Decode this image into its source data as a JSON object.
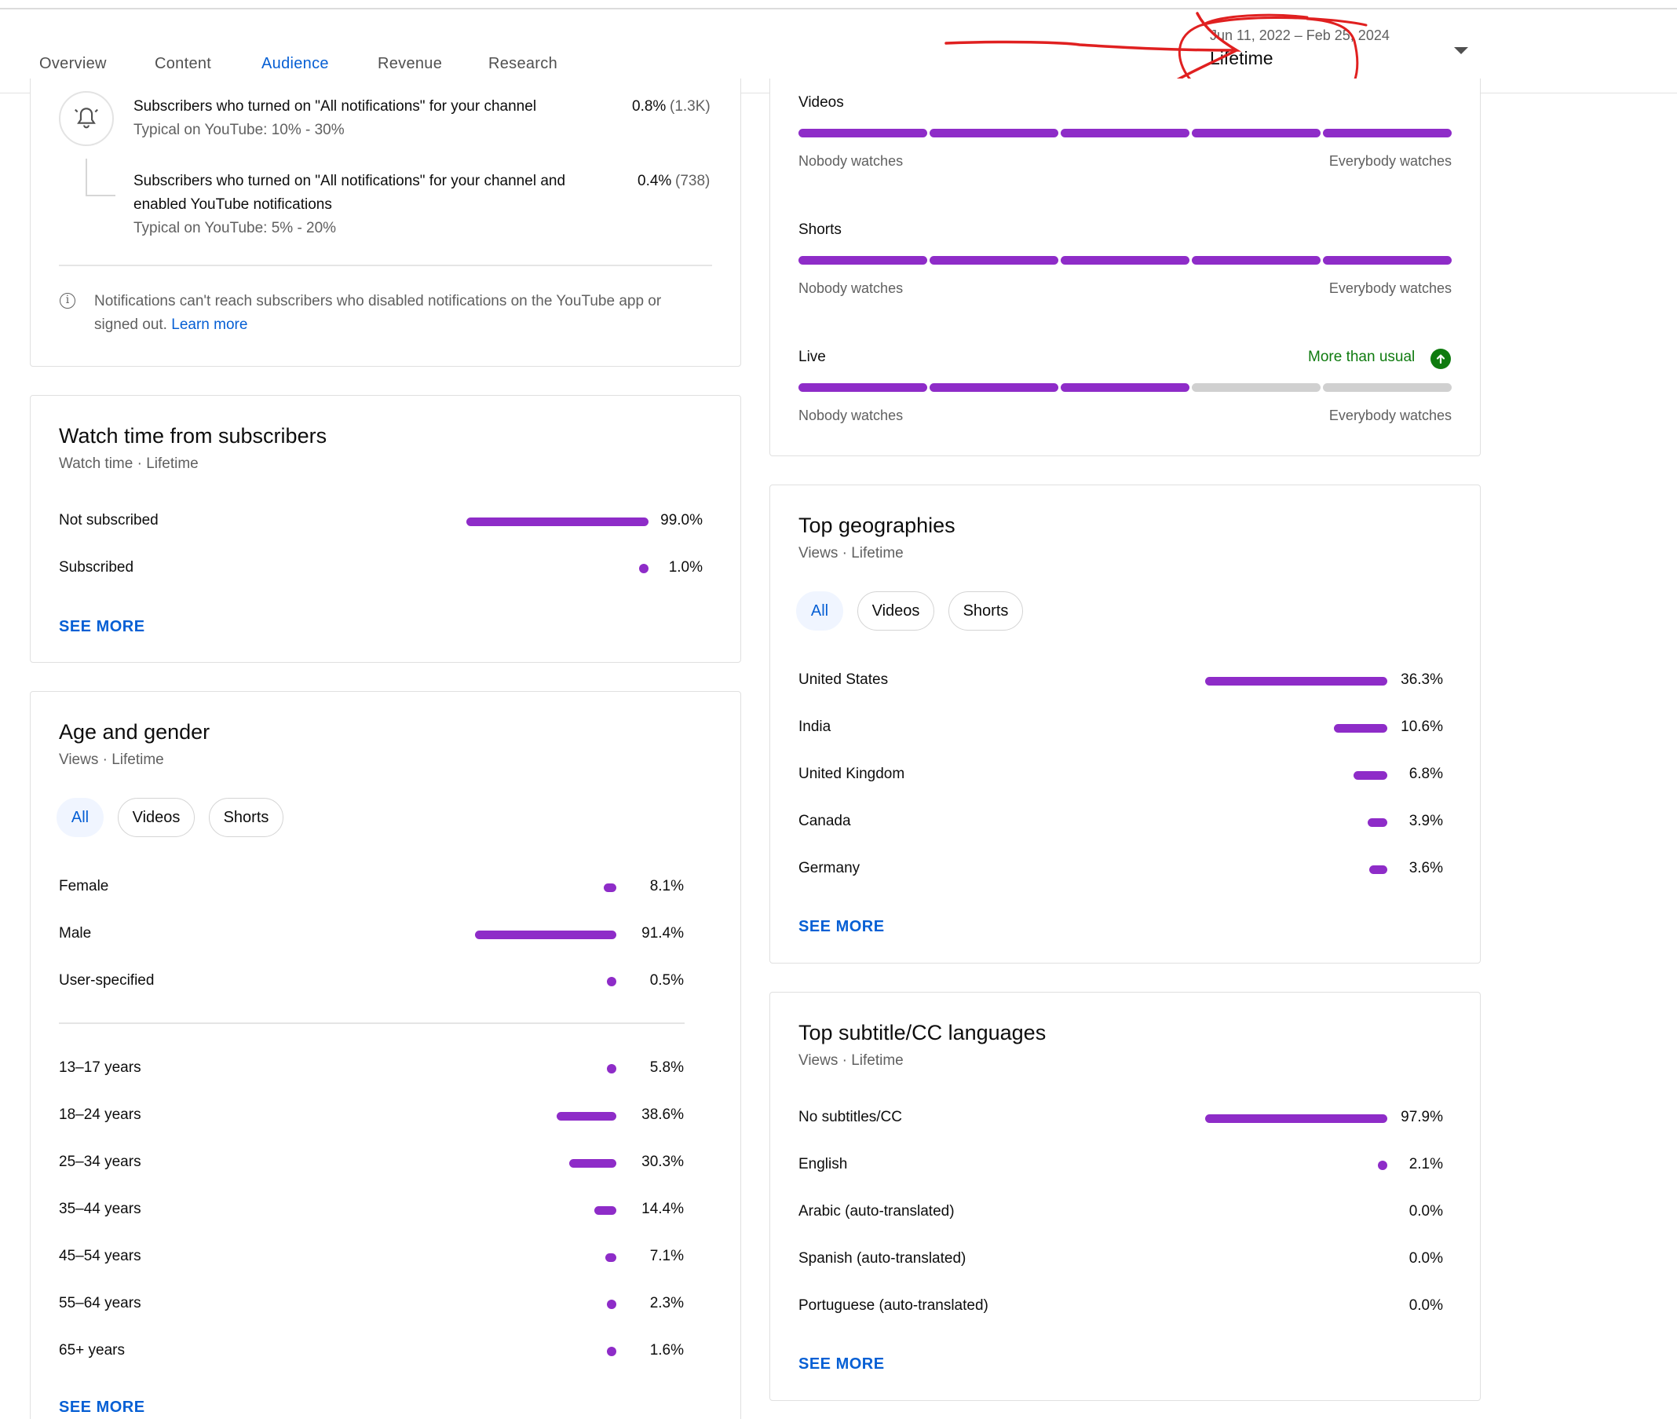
{
  "tabs": [
    {
      "label": "Overview",
      "active": false
    },
    {
      "label": "Content",
      "active": false
    },
    {
      "label": "Audience",
      "active": true
    },
    {
      "label": "Revenue",
      "active": false
    },
    {
      "label": "Research",
      "active": false
    }
  ],
  "date_picker": {
    "range": "Jun 11, 2022 – Feb 25, 2024",
    "label": "Lifetime"
  },
  "notifications": {
    "row1_label": "Subscribers who turned on \"All notifications\" for your channel",
    "row1_typical": "Typical on YouTube: 10% - 30%",
    "row1_pct": "0.8%",
    "row1_count": "(1.3K)",
    "row2_label_line1": "Subscribers who turned on \"All notifications\" for your channel and",
    "row2_label_line2": "enabled YouTube notifications",
    "row2_typical": "Typical on YouTube: 5% - 20%",
    "row2_pct": "0.4%",
    "row2_count": "(738)",
    "info_line1": "Notifications can't reach subscribers who disabled notifications on the YouTube app or",
    "info_line2": "signed out.",
    "learn_more": "Learn more"
  },
  "watch_from_subs": {
    "title": "Watch time from subscribers",
    "subtitle": "Watch time · Lifetime",
    "rows": [
      {
        "label": "Not subscribed",
        "value": "99.0%",
        "pct": 99.0
      },
      {
        "label": "Subscribed",
        "value": "1.0%",
        "pct": 1.0
      }
    ],
    "see_more": "SEE MORE"
  },
  "age_gender": {
    "title": "Age and gender",
    "subtitle": "Views · Lifetime",
    "chips": [
      "All",
      "Videos",
      "Shorts"
    ],
    "gender": [
      {
        "label": "Female",
        "value": "8.1%",
        "pct": 8.1
      },
      {
        "label": "Male",
        "value": "91.4%",
        "pct": 91.4
      },
      {
        "label": "User-specified",
        "value": "0.5%",
        "pct": 0.5
      }
    ],
    "ages": [
      {
        "label": "13–17 years",
        "value": "5.8%",
        "pct": 5.8
      },
      {
        "label": "18–24 years",
        "value": "38.6%",
        "pct": 38.6
      },
      {
        "label": "25–34 years",
        "value": "30.3%",
        "pct": 30.3
      },
      {
        "label": "35–44 years",
        "value": "14.4%",
        "pct": 14.4
      },
      {
        "label": "45–54 years",
        "value": "7.1%",
        "pct": 7.1
      },
      {
        "label": "55–64 years",
        "value": "2.3%",
        "pct": 2.3
      },
      {
        "label": "65+ years",
        "value": "1.6%",
        "pct": 1.6
      }
    ],
    "see_more": "SEE MORE"
  },
  "watch_habits": {
    "left_label": "Nobody watches",
    "right_label": "Everybody watches",
    "rows": [
      {
        "label": "Videos",
        "filled_segments": 5,
        "total_segments": 5,
        "note": ""
      },
      {
        "label": "Shorts",
        "filled_segments": 5,
        "total_segments": 5,
        "note": ""
      },
      {
        "label": "Live",
        "filled_segments": 3,
        "total_segments": 5,
        "note": "More than usual"
      }
    ]
  },
  "geographies": {
    "title": "Top geographies",
    "subtitle": "Views · Lifetime",
    "chips": [
      "All",
      "Videos",
      "Shorts"
    ],
    "rows": [
      {
        "label": "United States",
        "value": "36.3%",
        "pct": 36.3
      },
      {
        "label": "India",
        "value": "10.6%",
        "pct": 10.6
      },
      {
        "label": "United Kingdom",
        "value": "6.8%",
        "pct": 6.8
      },
      {
        "label": "Canada",
        "value": "3.9%",
        "pct": 3.9
      },
      {
        "label": "Germany",
        "value": "3.6%",
        "pct": 3.6
      }
    ],
    "see_more": "SEE MORE"
  },
  "subtitles": {
    "title": "Top subtitle/CC languages",
    "subtitle": "Views · Lifetime",
    "rows": [
      {
        "label": "No subtitles/CC",
        "value": "97.9%",
        "pct": 97.9
      },
      {
        "label": "English",
        "value": "2.1%",
        "pct": 2.1
      },
      {
        "label": "Arabic (auto-translated)",
        "value": "0.0%",
        "pct": 0.0
      },
      {
        "label": "Spanish (auto-translated)",
        "value": "0.0%",
        "pct": 0.0
      },
      {
        "label": "Portuguese (auto-translated)",
        "value": "0.0%",
        "pct": 0.0
      }
    ],
    "see_more": "SEE MORE"
  },
  "colors": {
    "accent": "#8e2cc8",
    "link": "#065fd4",
    "positive": "#0f7b0f",
    "annotation": "#e02020"
  },
  "icons": [
    "bell-icon",
    "info-icon",
    "arrow-up-icon",
    "dropdown-arrow-icon"
  ]
}
